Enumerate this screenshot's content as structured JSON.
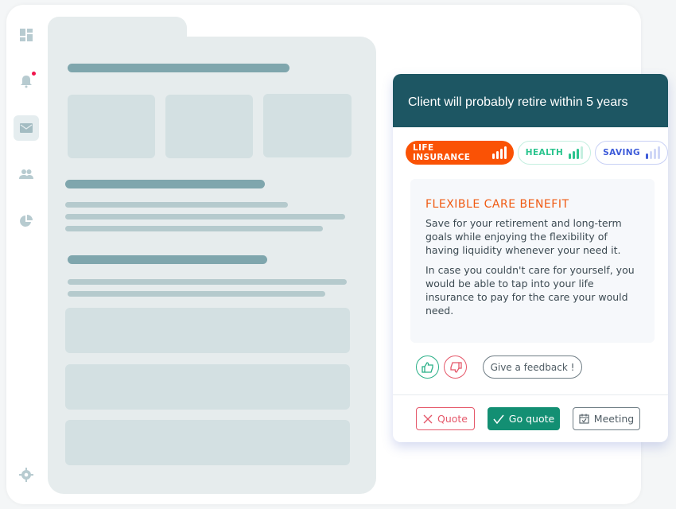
{
  "sidebar": {
    "items": [
      {
        "icon": "dashboard-icon"
      },
      {
        "icon": "bell-icon",
        "notification": true
      },
      {
        "icon": "mail-icon",
        "active": true
      },
      {
        "icon": "users-icon"
      },
      {
        "icon": "pie-chart-icon"
      },
      {
        "icon": "gear-icon"
      }
    ]
  },
  "card": {
    "title": "Client will probably retire within 5 years",
    "tabs": [
      {
        "label": "LIFE INSURANCE",
        "level": 4,
        "color": "#fa5205"
      },
      {
        "label": "HEALTH",
        "level": 3,
        "color": "#2bc48e"
      },
      {
        "label": "SAVING",
        "level": 1,
        "color": "#3d5bd9"
      }
    ],
    "benefit": {
      "title": "FLEXIBLE CARE BENEFIT",
      "paragraphs": [
        "Save for your retirement and long-term goals while enjoying the flexibility of having liquidity whenever your need it.",
        "In case you couldn't care for yourself, you would be able to tap into your life insurance to pay for the care your would need."
      ]
    },
    "feedback_label": "Give a feedback !",
    "actions": {
      "reject": "Quote",
      "go": "Go quote",
      "meeting": "Meeting"
    }
  },
  "colors": {
    "header": "#1d5663",
    "accent": "#f05a12",
    "primary": "#138f73",
    "danger": "#e5586a"
  }
}
